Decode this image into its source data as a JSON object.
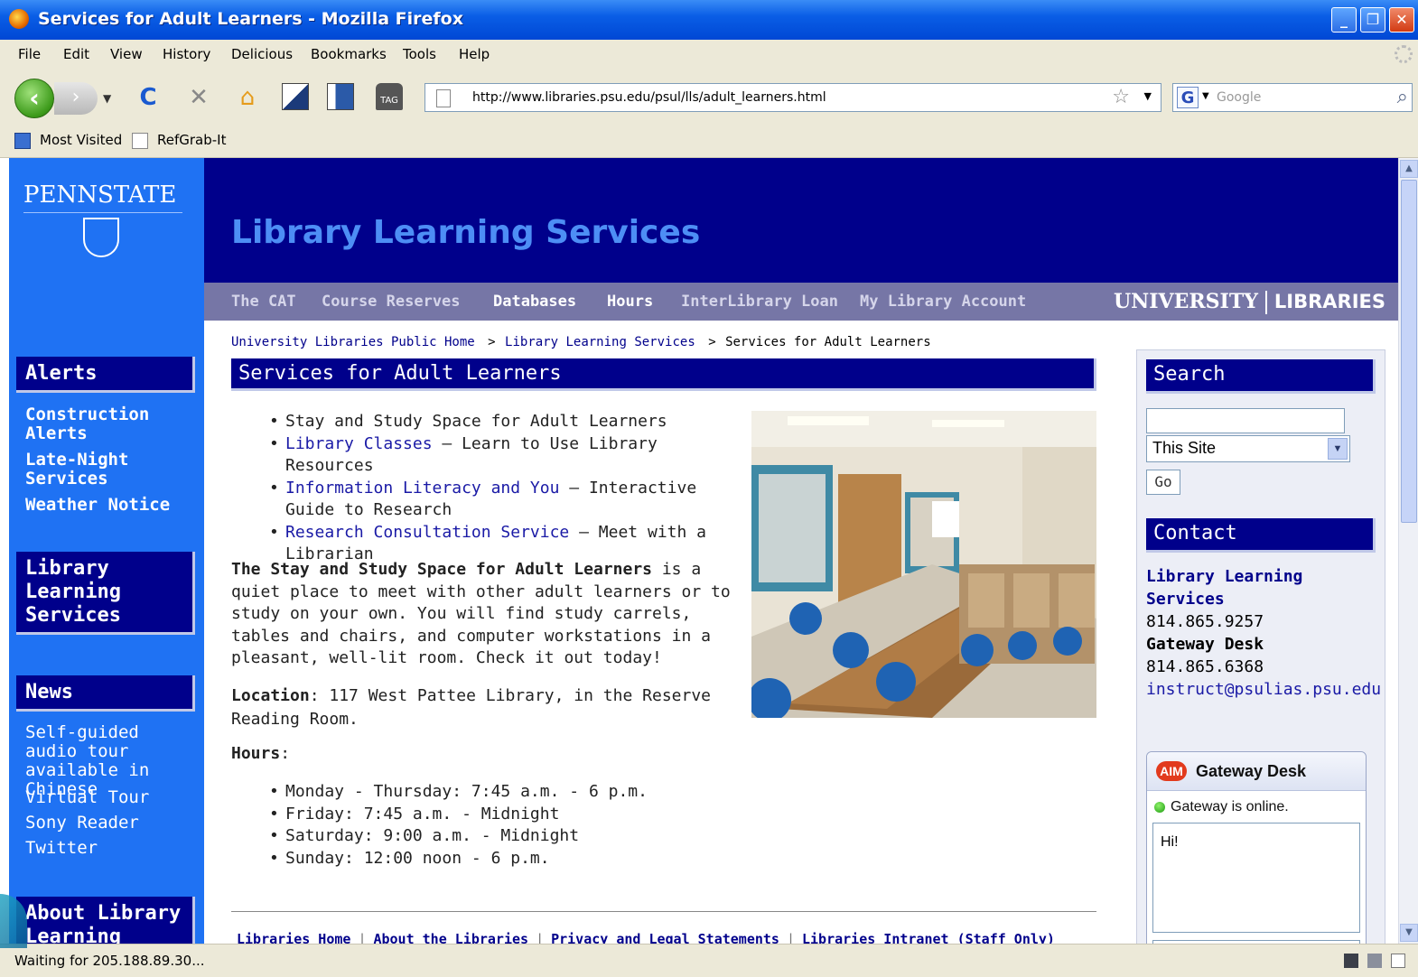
{
  "window": {
    "title": "Services for Adult Learners - Mozilla Firefox"
  },
  "menu": [
    "File",
    "Edit",
    "View",
    "History",
    "Delicious",
    "Bookmarks",
    "Tools",
    "Help"
  ],
  "navbar": {
    "url": "http://www.libraries.psu.edu/psul/lls/adult_learners.html",
    "search_engine": "G",
    "search_placeholder": "Google"
  },
  "bookmarks": [
    "Most Visited",
    "RefGrab-It"
  ],
  "site": {
    "logo": "PENNSTATE",
    "title": "Library Learning Services",
    "topnav": [
      "The CAT",
      "Course Reserves",
      "Databases",
      "Hours",
      "InterLibrary Loan",
      "My Library Account"
    ],
    "ul_logo_left": "UNIVERSITY",
    "ul_logo_right": "LIBRARIES"
  },
  "breadcrumb": {
    "home": "University Libraries Public Home",
    "sep": ">",
    "lls": "Library Learning Services",
    "current": "Services for Adult Learners"
  },
  "sidebar": {
    "alerts_title": "Alerts",
    "alerts": [
      "Construction Alerts",
      "Late-Night Services",
      "Weather Notice"
    ],
    "lls_title": "Library Learning Services",
    "news_title": "News",
    "news": [
      "Self-guided audio tour available in Chinese",
      "Virtual Tour",
      "Sony Reader",
      "Twitter"
    ],
    "about_title": "About Library Learning"
  },
  "main": {
    "title": "Services for Adult Learners",
    "bullets": [
      {
        "link": "",
        "text": "Stay and Study Space for Adult Learners"
      },
      {
        "link": "Library Classes",
        "text": " — Learn to Use Library Resources"
      },
      {
        "link": "Information Literacy and You",
        "text": " — Interactive Guide to Research"
      },
      {
        "link": "Research Consultation Service",
        "text": " — Meet with a Librarian"
      }
    ],
    "intro_bold": "The Stay and Study Space for Adult Learners",
    "intro_rest": " is a quiet place to meet with other adult learners or to study on your own. You will find study carrels, tables and chairs, and computer workstations in a pleasant, well-lit room. Check it out today!",
    "location_label": "Location",
    "location_text": ": 117 West Pattee Library, in the Reserve Reading Room.",
    "hours_label": "Hours",
    "hours_colon": ":",
    "hours": [
      "Monday - Thursday: 7:45 a.m. - 6 p.m.",
      "Friday: 7:45 a.m. - Midnight",
      "Saturday: 9:00 a.m. - Midnight",
      "Sunday: 12:00 noon - 6 p.m."
    ]
  },
  "footer": [
    "Libraries Home",
    "About the Libraries",
    "Privacy and Legal Statements",
    "Libraries Intranet (Staff Only)"
  ],
  "right": {
    "search_title": "Search",
    "scope": "This Site",
    "go": "Go",
    "contact_title": "Contact",
    "contact_name_1": "Library Learning",
    "contact_name_2": "Services",
    "phone_1": "814.865.9257",
    "desk": "Gateway Desk",
    "phone_2": "814.865.6368",
    "email": "instruct@psulias.psu.edu"
  },
  "aim": {
    "logo": "AIM",
    "title": "Gateway Desk",
    "status": "Gateway is online.",
    "message": "Hi!"
  },
  "status": {
    "text": "Waiting for 205.188.89.30..."
  }
}
